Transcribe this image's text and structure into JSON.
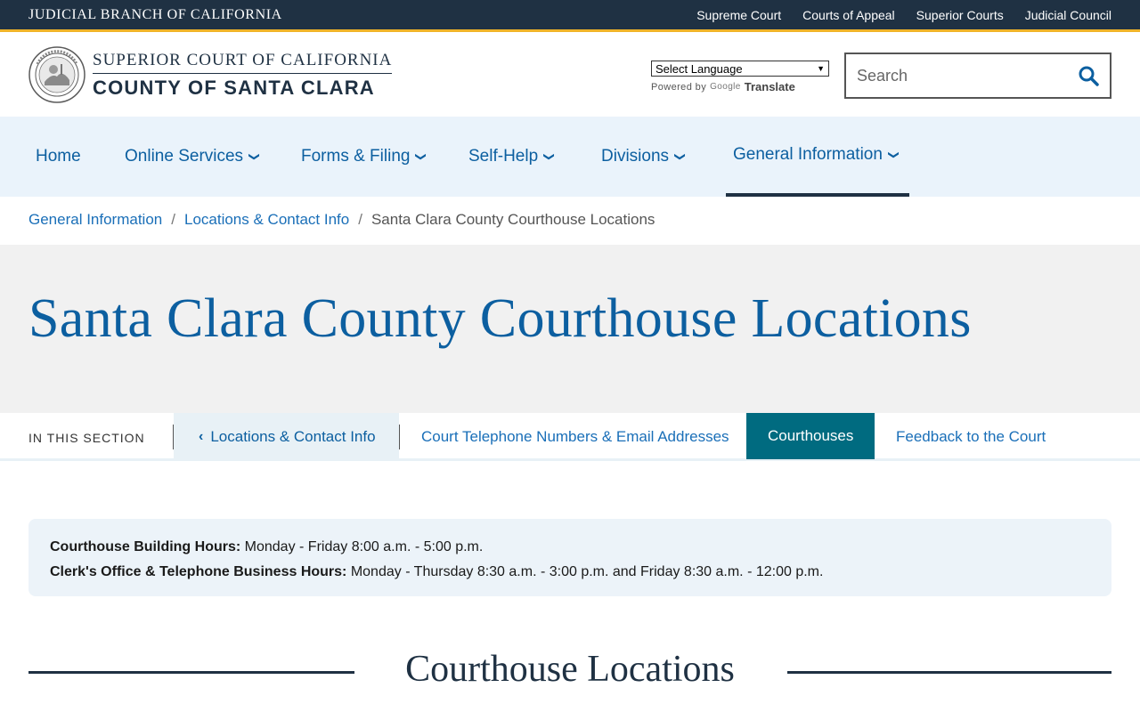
{
  "topbar": {
    "brand": "JUDICIAL BRANCH OF CALIFORNIA",
    "links": [
      "Supreme Court",
      "Courts of Appeal",
      "Superior Courts",
      "Judicial Council"
    ]
  },
  "header": {
    "court_line1": "SUPERIOR COURT OF CALIFORNIA",
    "court_line2": "COUNTY OF SANTA CLARA",
    "translate_select": "Select Language",
    "powered_by": "Powered by",
    "google": "Google",
    "translate": "Translate",
    "search_placeholder": "Search"
  },
  "nav": {
    "items": [
      {
        "label": "Home"
      },
      {
        "label": "Online Services"
      },
      {
        "label": "Forms & Filing"
      },
      {
        "label": "Self-Help"
      },
      {
        "label": "Divisions"
      },
      {
        "label": "General Information"
      }
    ]
  },
  "breadcrumb": {
    "items": [
      "General Information",
      "Locations & Contact Info"
    ],
    "current": "Santa Clara County Courthouse Locations"
  },
  "page": {
    "title": "Santa Clara County Courthouse Locations"
  },
  "section_nav": {
    "label": "IN THIS SECTION",
    "back": "Locations & Contact Info",
    "tabs": [
      "Court Telephone Numbers & Email Addresses",
      "Courthouses",
      "Feedback to the Court"
    ]
  },
  "hours": {
    "building_label": "Courthouse Building Hours:",
    "building_value": " Monday - Friday 8:00 a.m. - 5:00 p.m.",
    "clerk_label": "Clerk's Office & Telephone Business Hours:",
    "clerk_value": " Monday - Thursday 8:30 a.m. - 3:00 p.m. and Friday  8:30 a.m. - 12:00 p.m."
  },
  "section_heading": "Courthouse Locations",
  "colors": {
    "topbar": "#1f3143",
    "accent_gold": "#f0b429",
    "link_blue": "#0c5fa0",
    "active_tab": "#006b80"
  }
}
